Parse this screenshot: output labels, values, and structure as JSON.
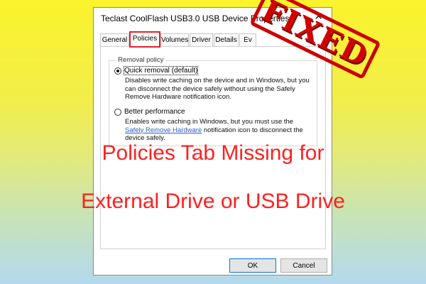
{
  "dialog": {
    "title": "Teclast CoolFlash USB3.0 USB Device Properties",
    "close_glyph": "✕",
    "tabs": [
      "General",
      "Policies",
      "Volumes",
      "Driver",
      "Details",
      "Ev"
    ],
    "active_tab": "Policies",
    "removal_policy": {
      "legend": "Removal policy",
      "quick": {
        "label": "Quick removal (default)",
        "checked": true,
        "description": "Disables write caching on the device and in Windows, but you can disconnect the device safely without using the Safely Remove Hardware notification icon."
      },
      "better": {
        "label": "Better performance",
        "checked": false,
        "description_before": "Enables write caching in Windows, but you must use the",
        "description_link": "Safely Remove Hardware",
        "description_after": "notification icon to disconnect the device safely."
      }
    },
    "buttons": {
      "ok": "OK",
      "cancel": "Cancel"
    }
  },
  "stamp": {
    "text": "FIXED",
    "color": "#d20000"
  },
  "headline": {
    "line1": "Policies Tab Missing for",
    "line2": "External Drive or USB Drive",
    "color": "#ff2020"
  }
}
